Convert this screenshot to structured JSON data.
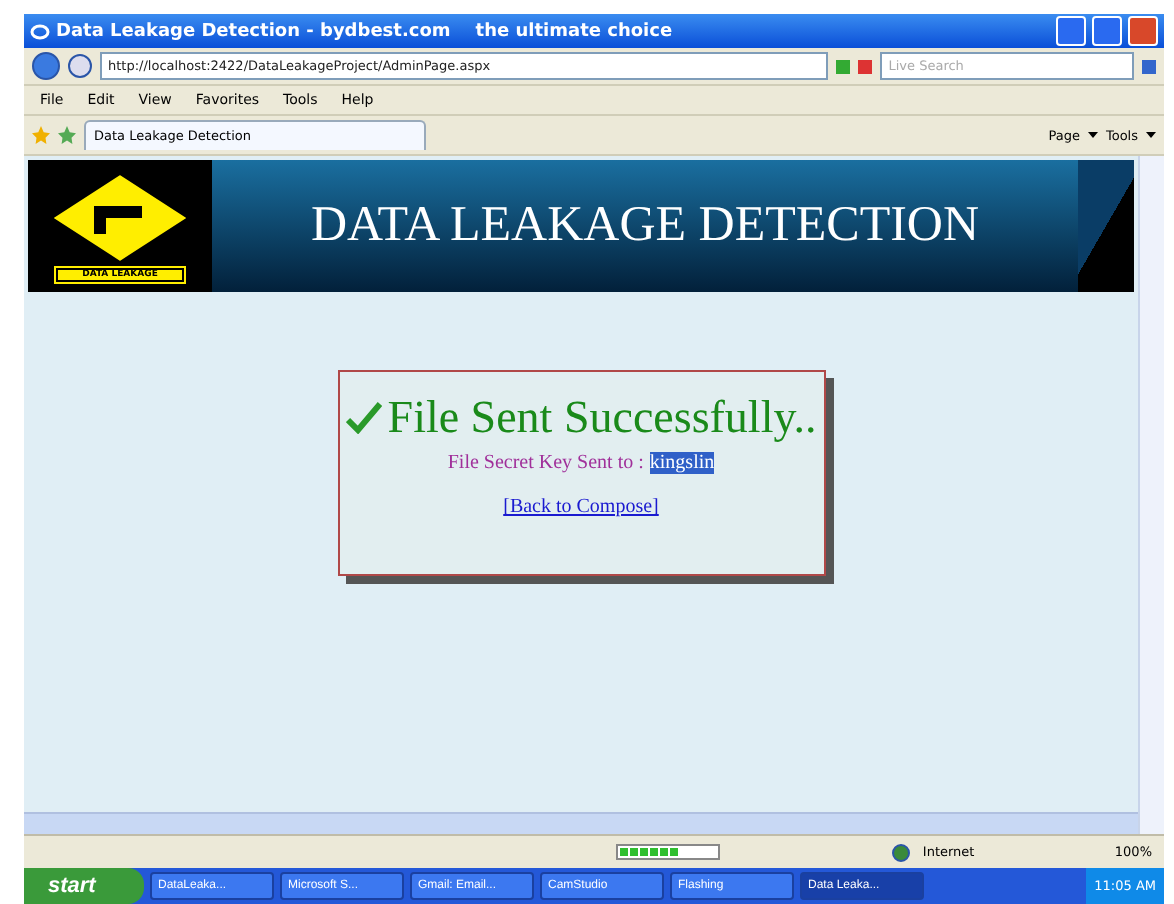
{
  "window": {
    "title": "Data Leakage Detection - bydbest.com    the ultimate choice"
  },
  "address_bar": {
    "url": "http://localhost:2422/DataLeakageProject/AdminPage.aspx",
    "search": {
      "placeholder": "Live Search"
    }
  },
  "menu": [
    "File",
    "Edit",
    "View",
    "Favorites",
    "Tools",
    "Help"
  ],
  "tabs": [
    {
      "label": "Data Leakage Detection",
      "selected": true
    }
  ],
  "command_bar": [
    {
      "label": "Page"
    },
    {
      "label": "Tools"
    }
  ],
  "banner": {
    "logo_label": "DATA LEAKAGE",
    "title": "DATA LEAKAGE DETECTION"
  },
  "result_card": {
    "heading": "File Sent Successfully..",
    "message": "File Secret Key Sent to :",
    "recipient": "kingslin",
    "link": "[Back to Compose]"
  },
  "status_bar": {
    "progress": {
      "level": 0.6
    },
    "zone": "Internet",
    "zoom": "100%"
  },
  "taskbar": {
    "start": "start",
    "tasks": [
      {
        "label": "DataLeaka...",
        "selected": false
      },
      {
        "label": "Microsoft S...",
        "selected": false
      },
      {
        "label": "Gmail: Email...",
        "selected": false
      },
      {
        "label": "CamStudio",
        "selected": false
      },
      {
        "label": "Flashing",
        "selected": false
      },
      {
        "label": "Data Leaka...",
        "selected": true
      }
    ],
    "clock": "11:05 AM"
  }
}
